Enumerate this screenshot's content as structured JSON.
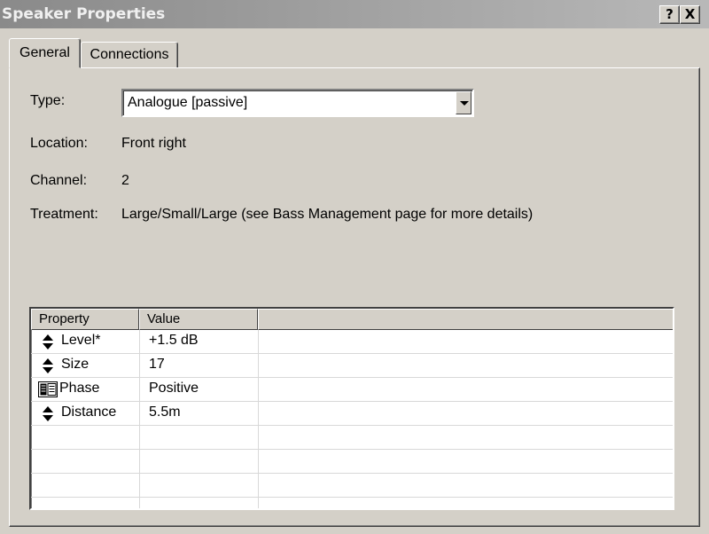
{
  "window": {
    "title": "Speaker Properties",
    "help_label": "?",
    "close_label": "X"
  },
  "tabs": [
    {
      "label": "General",
      "active": true
    },
    {
      "label": "Connections",
      "active": false
    }
  ],
  "fields": {
    "type_label": "Type:",
    "type_value": "Analogue [passive]",
    "location_label": "Location:",
    "location_value": "Front right",
    "channel_label": "Channel:",
    "channel_value": "2",
    "treatment_label": "Treatment:",
    "treatment_value": "Large/Small/Large (see Bass Management page for more details)"
  },
  "grid": {
    "columns": [
      "Property",
      "Value",
      ""
    ],
    "rows": [
      {
        "icon": "spin-arrows-icon",
        "property": "Level*",
        "value": "+1.5 dB"
      },
      {
        "icon": "spin-arrows-icon",
        "property": "Size",
        "value": "17"
      },
      {
        "icon": "list-select-icon",
        "property": "Phase",
        "value": "Positive"
      },
      {
        "icon": "spin-arrows-icon",
        "property": "Distance",
        "value": "5.5m"
      }
    ]
  },
  "colors": {
    "face": "#d4d0c8",
    "titlebar": "#9a9a9a",
    "grid_background": "#ffffff"
  }
}
